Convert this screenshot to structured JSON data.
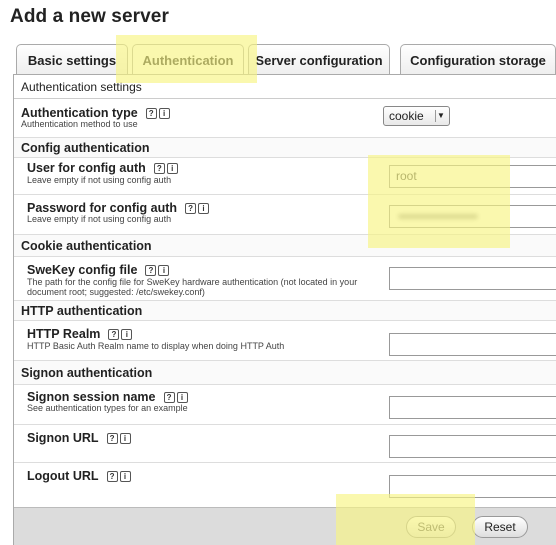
{
  "page": {
    "title": "Add a new server"
  },
  "tabs": [
    {
      "label": "Basic settings"
    },
    {
      "label": "Authentication"
    },
    {
      "label": "Server configuration"
    },
    {
      "label": "Configuration storage"
    }
  ],
  "panel": {
    "legend": "Authentication settings",
    "auth_type": {
      "label": "Authentication type",
      "desc": "Authentication method to use",
      "value": "cookie"
    },
    "sections": {
      "config": "Config authentication",
      "cookie": "Cookie authentication",
      "http": "HTTP authentication",
      "signon": "Signon authentication"
    },
    "user": {
      "label": "User for config auth",
      "desc": "Leave empty if not using config auth",
      "value": "root"
    },
    "password": {
      "label": "Password for config auth",
      "desc": "Leave empty if not using config auth"
    },
    "swekey": {
      "label": "SweKey config file",
      "desc": "The path for the config file for SweKey hardware authentication (not located in your document root; suggested: /etc/swekey.conf)"
    },
    "realm": {
      "label": "HTTP Realm",
      "desc": "HTTP Basic Auth Realm name to display when doing HTTP Auth"
    },
    "session": {
      "label": "Signon session name",
      "desc": "See authentication types for an example"
    },
    "signon_url": {
      "label": "Signon URL"
    },
    "logout_url": {
      "label": "Logout URL"
    }
  },
  "help_icons": {
    "doc": "?",
    "info": "i"
  },
  "footer": {
    "save_label": "Save",
    "reset_label": "Reset"
  },
  "colors": {
    "highlight": "#f8f582"
  }
}
